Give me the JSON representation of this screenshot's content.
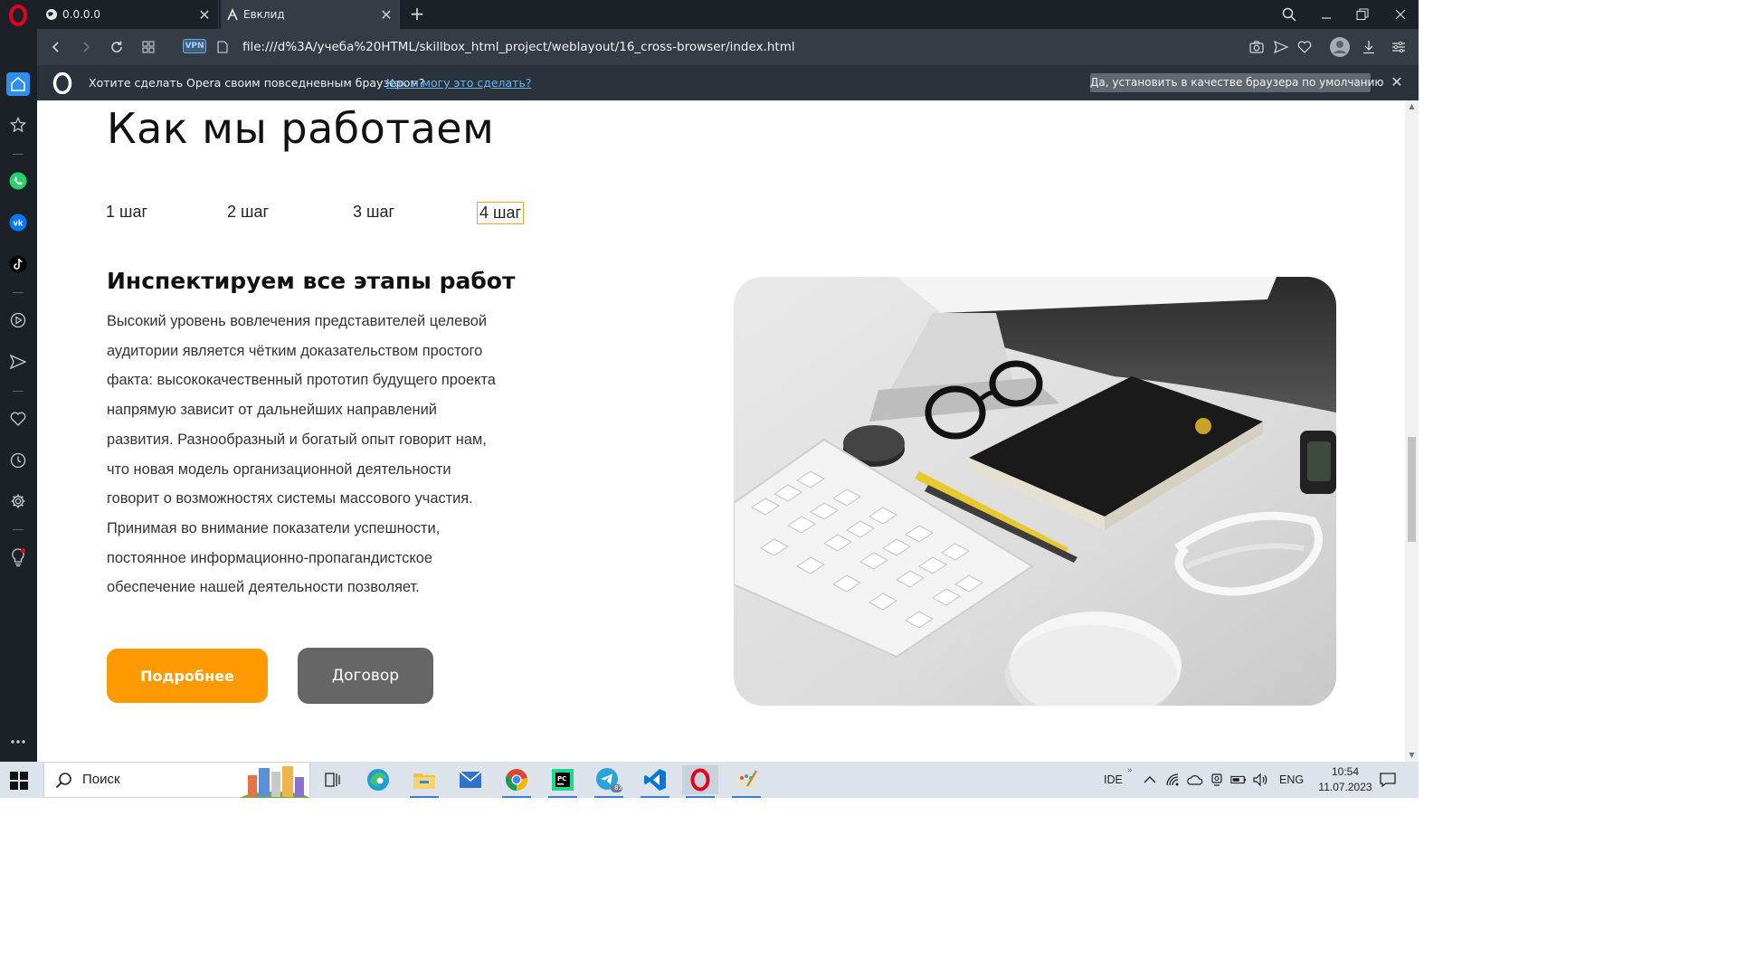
{
  "browser": {
    "tabs": [
      {
        "title": "0.0.0.0",
        "icon": "globe-icon"
      },
      {
        "title": "Евклид",
        "icon": "euclid-icon",
        "active": true
      }
    ],
    "url": "file:///d%3A/учеба%20HTML/skillbox_html_project/weblayout/16_cross-browser/index.html",
    "vpn_label": "VPN"
  },
  "notification": {
    "text": "Хотите сделать Opera своим повседневным браузером?",
    "link": "Как я могу это сделать?",
    "button": "Да, установить в качестве браузера по умолчанию"
  },
  "page": {
    "title": "Как мы работаем",
    "steps": [
      "1 шаг",
      "2 шаг",
      "3 шаг",
      "4 шаг"
    ],
    "active_step": 4,
    "section_title": "Инспектируем все этапы работ",
    "section_lines": [
      "Высокий уровень вовлечения представителей целевой",
      "аудитории является чётким доказательством простого",
      "факта: высококачественный прототип будущего проекта",
      "напрямую зависит от дальнейших направлений",
      "развития. Разнообразный и богатый опыт говорит нам,",
      "что новая модель организационной деятельности",
      "говорит о возможностях системы массового участия.",
      "Принимая во внимание показатели успешности,",
      "постоянное информационно-пропагандистское",
      "обеспечение нашей деятельности позволяет."
    ],
    "btn_more": "Подробнее",
    "btn_contract": "Договор"
  },
  "taskbar": {
    "search_placeholder": "Поиск",
    "tray_ide": "IDE",
    "tray_lang": "ENG",
    "time": "10:54",
    "date": "11.07.2023",
    "telegram_badge": "83"
  },
  "colors": {
    "accent_orange": "#ff9900",
    "button_gray": "#666666",
    "opera_red": "#e3001b"
  }
}
